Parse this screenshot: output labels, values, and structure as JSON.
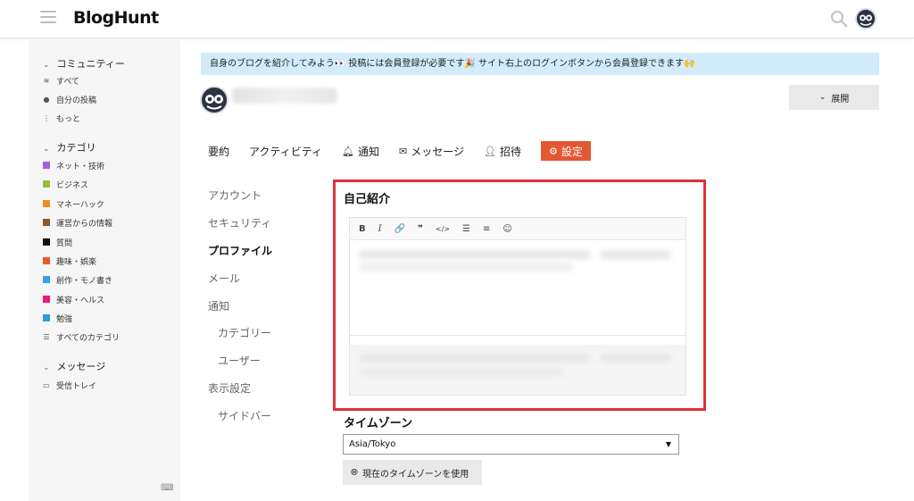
{
  "header": {
    "logo": "BlogHunt",
    "hamburger_icon": "menu-icon",
    "search_icon": "search-icon"
  },
  "sidebar": {
    "community": {
      "title": "コミュニティー",
      "items": [
        {
          "label": "すべて",
          "icon": "layers-icon"
        },
        {
          "label": "自分の投稿",
          "icon": "user-icon"
        },
        {
          "label": "もっと",
          "icon": "more-vertical-icon"
        }
      ]
    },
    "categories": {
      "title": "カテゴリ",
      "items": [
        {
          "label": "ネット・技術",
          "color": "#a062dc"
        },
        {
          "label": "ビジネス",
          "color": "#9bbd3a"
        },
        {
          "label": "マネーハック",
          "color": "#f28c1f"
        },
        {
          "label": "運営からの情報",
          "color": "#8b5a2b"
        },
        {
          "label": "質問",
          "color": "#111111"
        },
        {
          "label": "趣味・娯楽",
          "color": "#ef5a24"
        },
        {
          "label": "創作・モノ書き",
          "color": "#3aa0e3"
        },
        {
          "label": "美容・ヘルス",
          "color": "#e8197f"
        },
        {
          "label": "勉強",
          "color": "#2f9be0"
        },
        {
          "label": "すべてのカテゴリ",
          "color": ""
        }
      ]
    },
    "messages": {
      "title": "メッセージ",
      "items": [
        {
          "label": "受信トレイ",
          "icon": "inbox-icon"
        }
      ]
    }
  },
  "banner": {
    "text": "自身のブログを紹介してみよう👀 投稿には会員登録が必要です🎉 サイト右上のログインボタンから会員登録できます🙌"
  },
  "profile": {
    "expand_label": "展開"
  },
  "tabs": [
    {
      "label": "要約",
      "icon": ""
    },
    {
      "label": "アクティビティ",
      "icon": ""
    },
    {
      "label": "通知",
      "icon": "bell-icon"
    },
    {
      "label": "メッセージ",
      "icon": "envelope-icon"
    },
    {
      "label": "招待",
      "icon": "user-plus-icon"
    },
    {
      "label": "設定",
      "icon": "gear-icon",
      "active": true
    }
  ],
  "settings_nav": [
    {
      "label": "アカウント"
    },
    {
      "label": "セキュリティ"
    },
    {
      "label": "プロファイル",
      "active": true
    },
    {
      "label": "メール"
    },
    {
      "label": "通知"
    },
    {
      "label": "カテゴリー",
      "indent": true
    },
    {
      "label": "ユーザー",
      "indent": true
    },
    {
      "label": "表示設定"
    },
    {
      "label": "サイドバー",
      "indent": true
    }
  ],
  "bio": {
    "title": "自己紹介",
    "toolbar": [
      "B",
      "I",
      "🔗",
      "❞",
      "</>",
      "☰",
      "≡",
      "☺"
    ]
  },
  "timezone": {
    "title": "タイムゾーン",
    "selected": "Asia/Tokyo",
    "use_current_label": "現在のタイムゾーンを使用"
  },
  "colors": {
    "accent": "#e45735",
    "banner_bg": "#d2ecfb",
    "highlight": "#e0313a"
  }
}
